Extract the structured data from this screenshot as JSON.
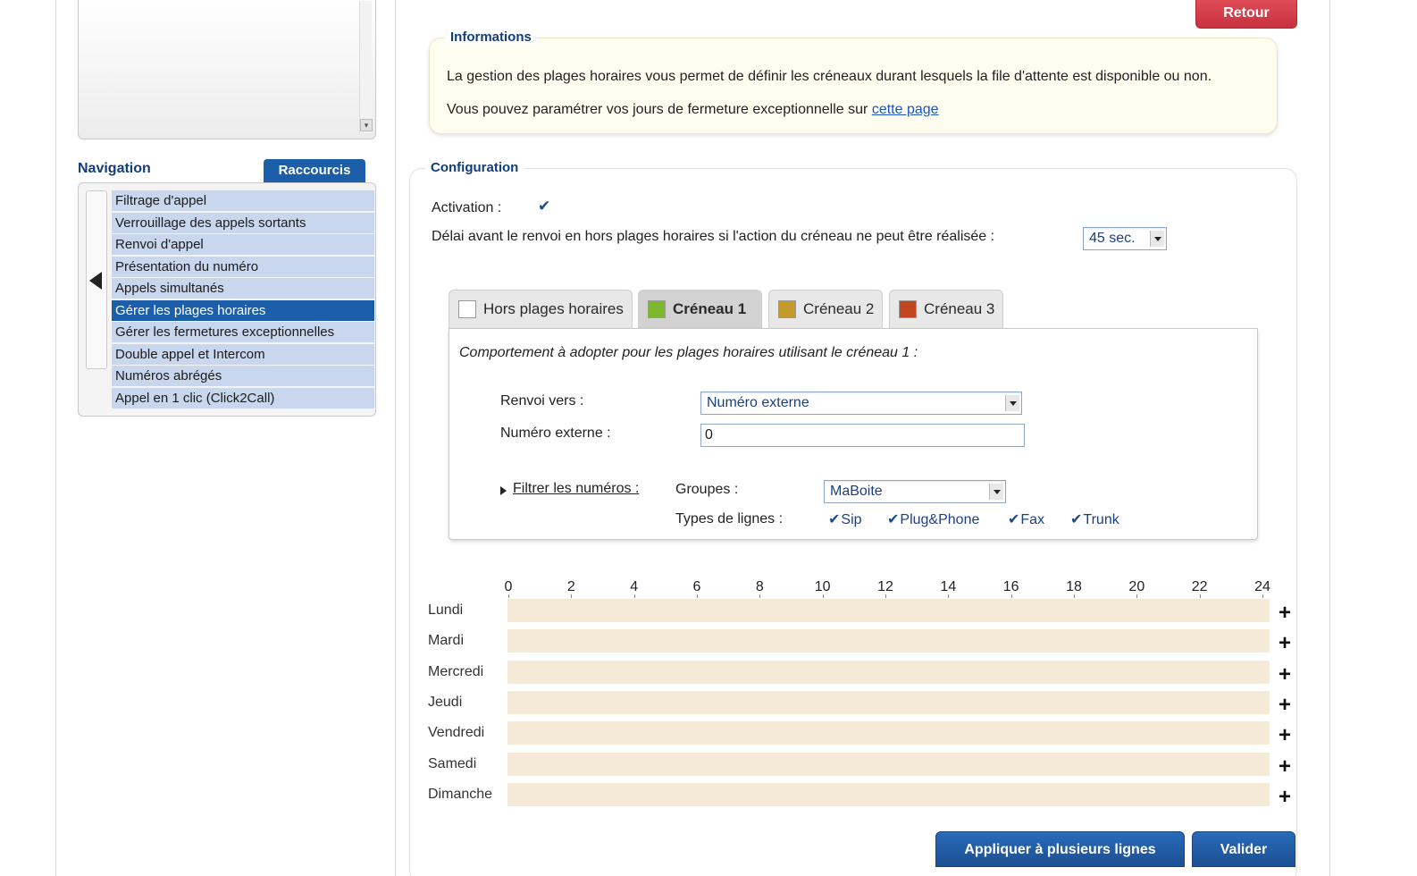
{
  "header": {
    "back_button": "Retour"
  },
  "sidebar": {
    "title": "Navigation",
    "shortcuts_tab": "Raccourcis",
    "items": [
      {
        "label": "Filtrage d'appel",
        "active": false
      },
      {
        "label": "Verrouillage des appels sortants",
        "active": false
      },
      {
        "label": "Renvoi d'appel",
        "active": false
      },
      {
        "label": "Présentation du numéro",
        "active": false
      },
      {
        "label": "Appels simultanés",
        "active": false
      },
      {
        "label": "Gérer les plages horaires",
        "active": true
      },
      {
        "label": "Gérer les fermetures exceptionnelles",
        "active": false
      },
      {
        "label": "Double appel et Intercom",
        "active": false
      },
      {
        "label": "Numéros abrégés",
        "active": false
      },
      {
        "label": "Appel en 1 clic (Click2Call)",
        "active": false
      }
    ]
  },
  "info": {
    "legend": "Informations",
    "line1": "La gestion des plages horaires vous permet de définir les créneaux durant lesquels la file d'attente est disponible ou non.",
    "line2_prefix": "Vous pouvez paramétrer vos jours de fermeture exceptionnelle sur ",
    "line2_link": "cette page"
  },
  "config": {
    "legend": "Configuration",
    "activation_label": "Activation :",
    "activation_checked": true,
    "delay_label": "Délai avant le renvoi en hors plages horaires si l'action du créneau ne peut être réalisée :",
    "delay_value": "45 sec."
  },
  "tabs": [
    {
      "label": "Hors plages horaires",
      "color": "#ffffff",
      "active": false
    },
    {
      "label": "Créneau 1",
      "color": "#7cb82f",
      "active": true
    },
    {
      "label": "Créneau 2",
      "color": "#c49a2a",
      "active": false
    },
    {
      "label": "Créneau 3",
      "color": "#c2461f",
      "active": false
    }
  ],
  "slot": {
    "description": "Comportement à adopter pour les plages horaires utilisant le créneau 1 :",
    "forward_label": "Renvoi vers :",
    "forward_value": "Numéro externe",
    "external_label": "Numéro externe :",
    "external_value": "0",
    "filter_link": "Filtrer les numéros :",
    "groups_label": "Groupes :",
    "groups_value": "MaBoite",
    "line_types_label": "Types de lignes :",
    "line_types": [
      {
        "label": "Sip",
        "checked": true
      },
      {
        "label": "Plug&Phone",
        "checked": true
      },
      {
        "label": "Fax",
        "checked": true
      },
      {
        "label": "Trunk",
        "checked": true
      }
    ]
  },
  "schedule": {
    "hours": [
      "0",
      "2",
      "4",
      "6",
      "8",
      "10",
      "12",
      "14",
      "16",
      "18",
      "20",
      "22",
      "24"
    ],
    "days": [
      "Lundi",
      "Mardi",
      "Mercredi",
      "Jeudi",
      "Vendredi",
      "Samedi",
      "Dimanche"
    ],
    "add_symbol": "+",
    "bar_color": "#f4ead7"
  },
  "footer": {
    "apply_button": "Appliquer à plusieurs lignes",
    "validate_button": "Valider"
  }
}
